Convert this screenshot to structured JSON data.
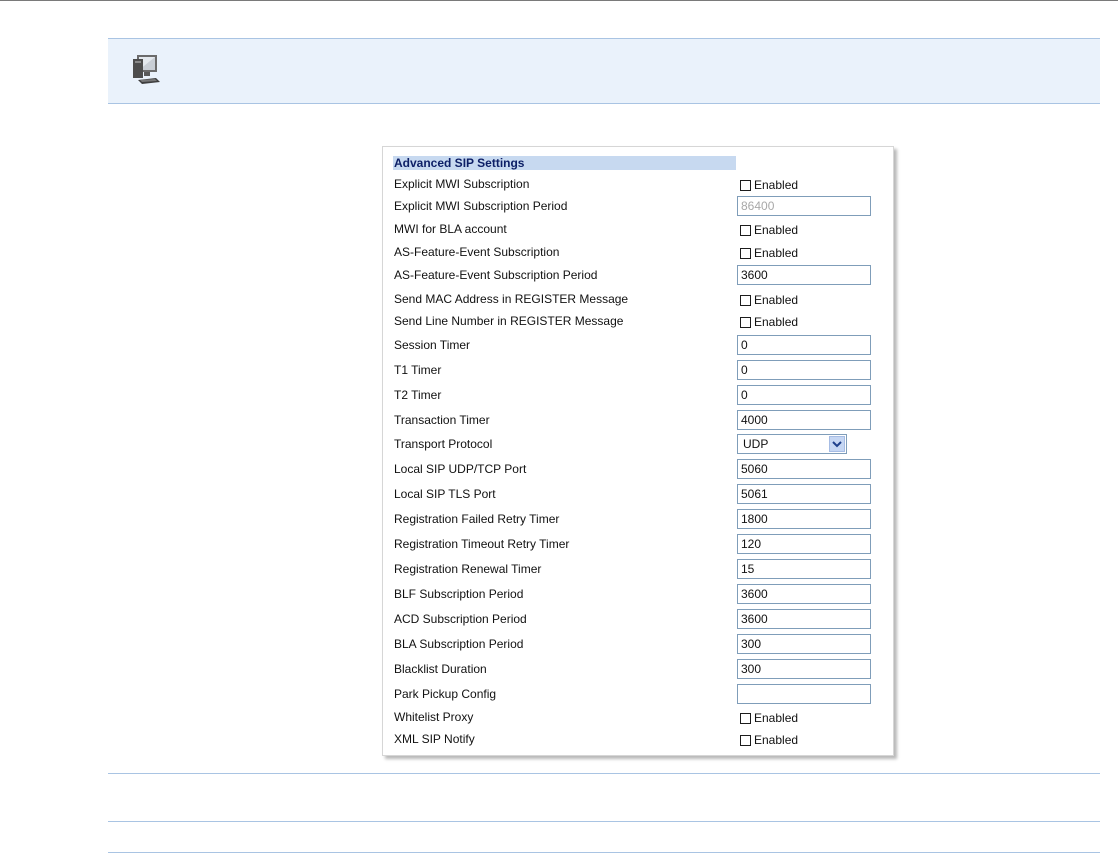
{
  "panel": {
    "header": "Advanced SIP Settings",
    "checkbox_text": "Enabled",
    "rows": [
      {
        "label": "Explicit MWI Subscription",
        "type": "checkbox",
        "checked": false
      },
      {
        "label": "Explicit MWI Subscription Period",
        "type": "text",
        "value": "86400",
        "disabled": true
      },
      {
        "label": "MWI for BLA account",
        "type": "checkbox",
        "checked": false
      },
      {
        "label": "AS-Feature-Event Subscription",
        "type": "checkbox",
        "checked": false
      },
      {
        "label": "AS-Feature-Event Subscription Period",
        "type": "text",
        "value": "3600"
      },
      {
        "label": "Send MAC Address in REGISTER Message",
        "type": "checkbox",
        "checked": false
      },
      {
        "label": "Send Line Number in REGISTER Message",
        "type": "checkbox",
        "checked": false
      },
      {
        "label": "Session Timer",
        "type": "text",
        "value": "0"
      },
      {
        "label": "T1 Timer",
        "type": "text",
        "value": "0"
      },
      {
        "label": "T2 Timer",
        "type": "text",
        "value": "0"
      },
      {
        "label": "Transaction Timer",
        "type": "text",
        "value": "4000"
      },
      {
        "label": "Transport Protocol",
        "type": "select",
        "value": "UDP"
      },
      {
        "label": "Local SIP UDP/TCP Port",
        "type": "text",
        "value": "5060"
      },
      {
        "label": "Local SIP TLS Port",
        "type": "text",
        "value": "5061"
      },
      {
        "label": "Registration Failed Retry Timer",
        "type": "text",
        "value": "1800"
      },
      {
        "label": "Registration Timeout Retry Timer",
        "type": "text",
        "value": "120"
      },
      {
        "label": "Registration Renewal Timer",
        "type": "text",
        "value": "15"
      },
      {
        "label": "BLF Subscription Period",
        "type": "text",
        "value": "3600"
      },
      {
        "label": "ACD Subscription Period",
        "type": "text",
        "value": "3600"
      },
      {
        "label": "BLA Subscription Period",
        "type": "text",
        "value": "300"
      },
      {
        "label": "Blacklist Duration",
        "type": "text",
        "value": "300"
      },
      {
        "label": "Park Pickup Config",
        "type": "text",
        "value": ""
      },
      {
        "label": "Whitelist Proxy",
        "type": "checkbox",
        "checked": false
      },
      {
        "label": "XML SIP Notify",
        "type": "checkbox",
        "checked": false
      }
    ]
  },
  "colors": {
    "banner_bg": "#eaf2fb",
    "rule": "#a9c4e3",
    "header_bg": "#c7d9f0",
    "header_text": "#0d1f66",
    "input_border": "#7f9db9"
  },
  "icons": {
    "banner": "computer-monitor-icon",
    "select_arrow": "chevron-down-icon"
  }
}
